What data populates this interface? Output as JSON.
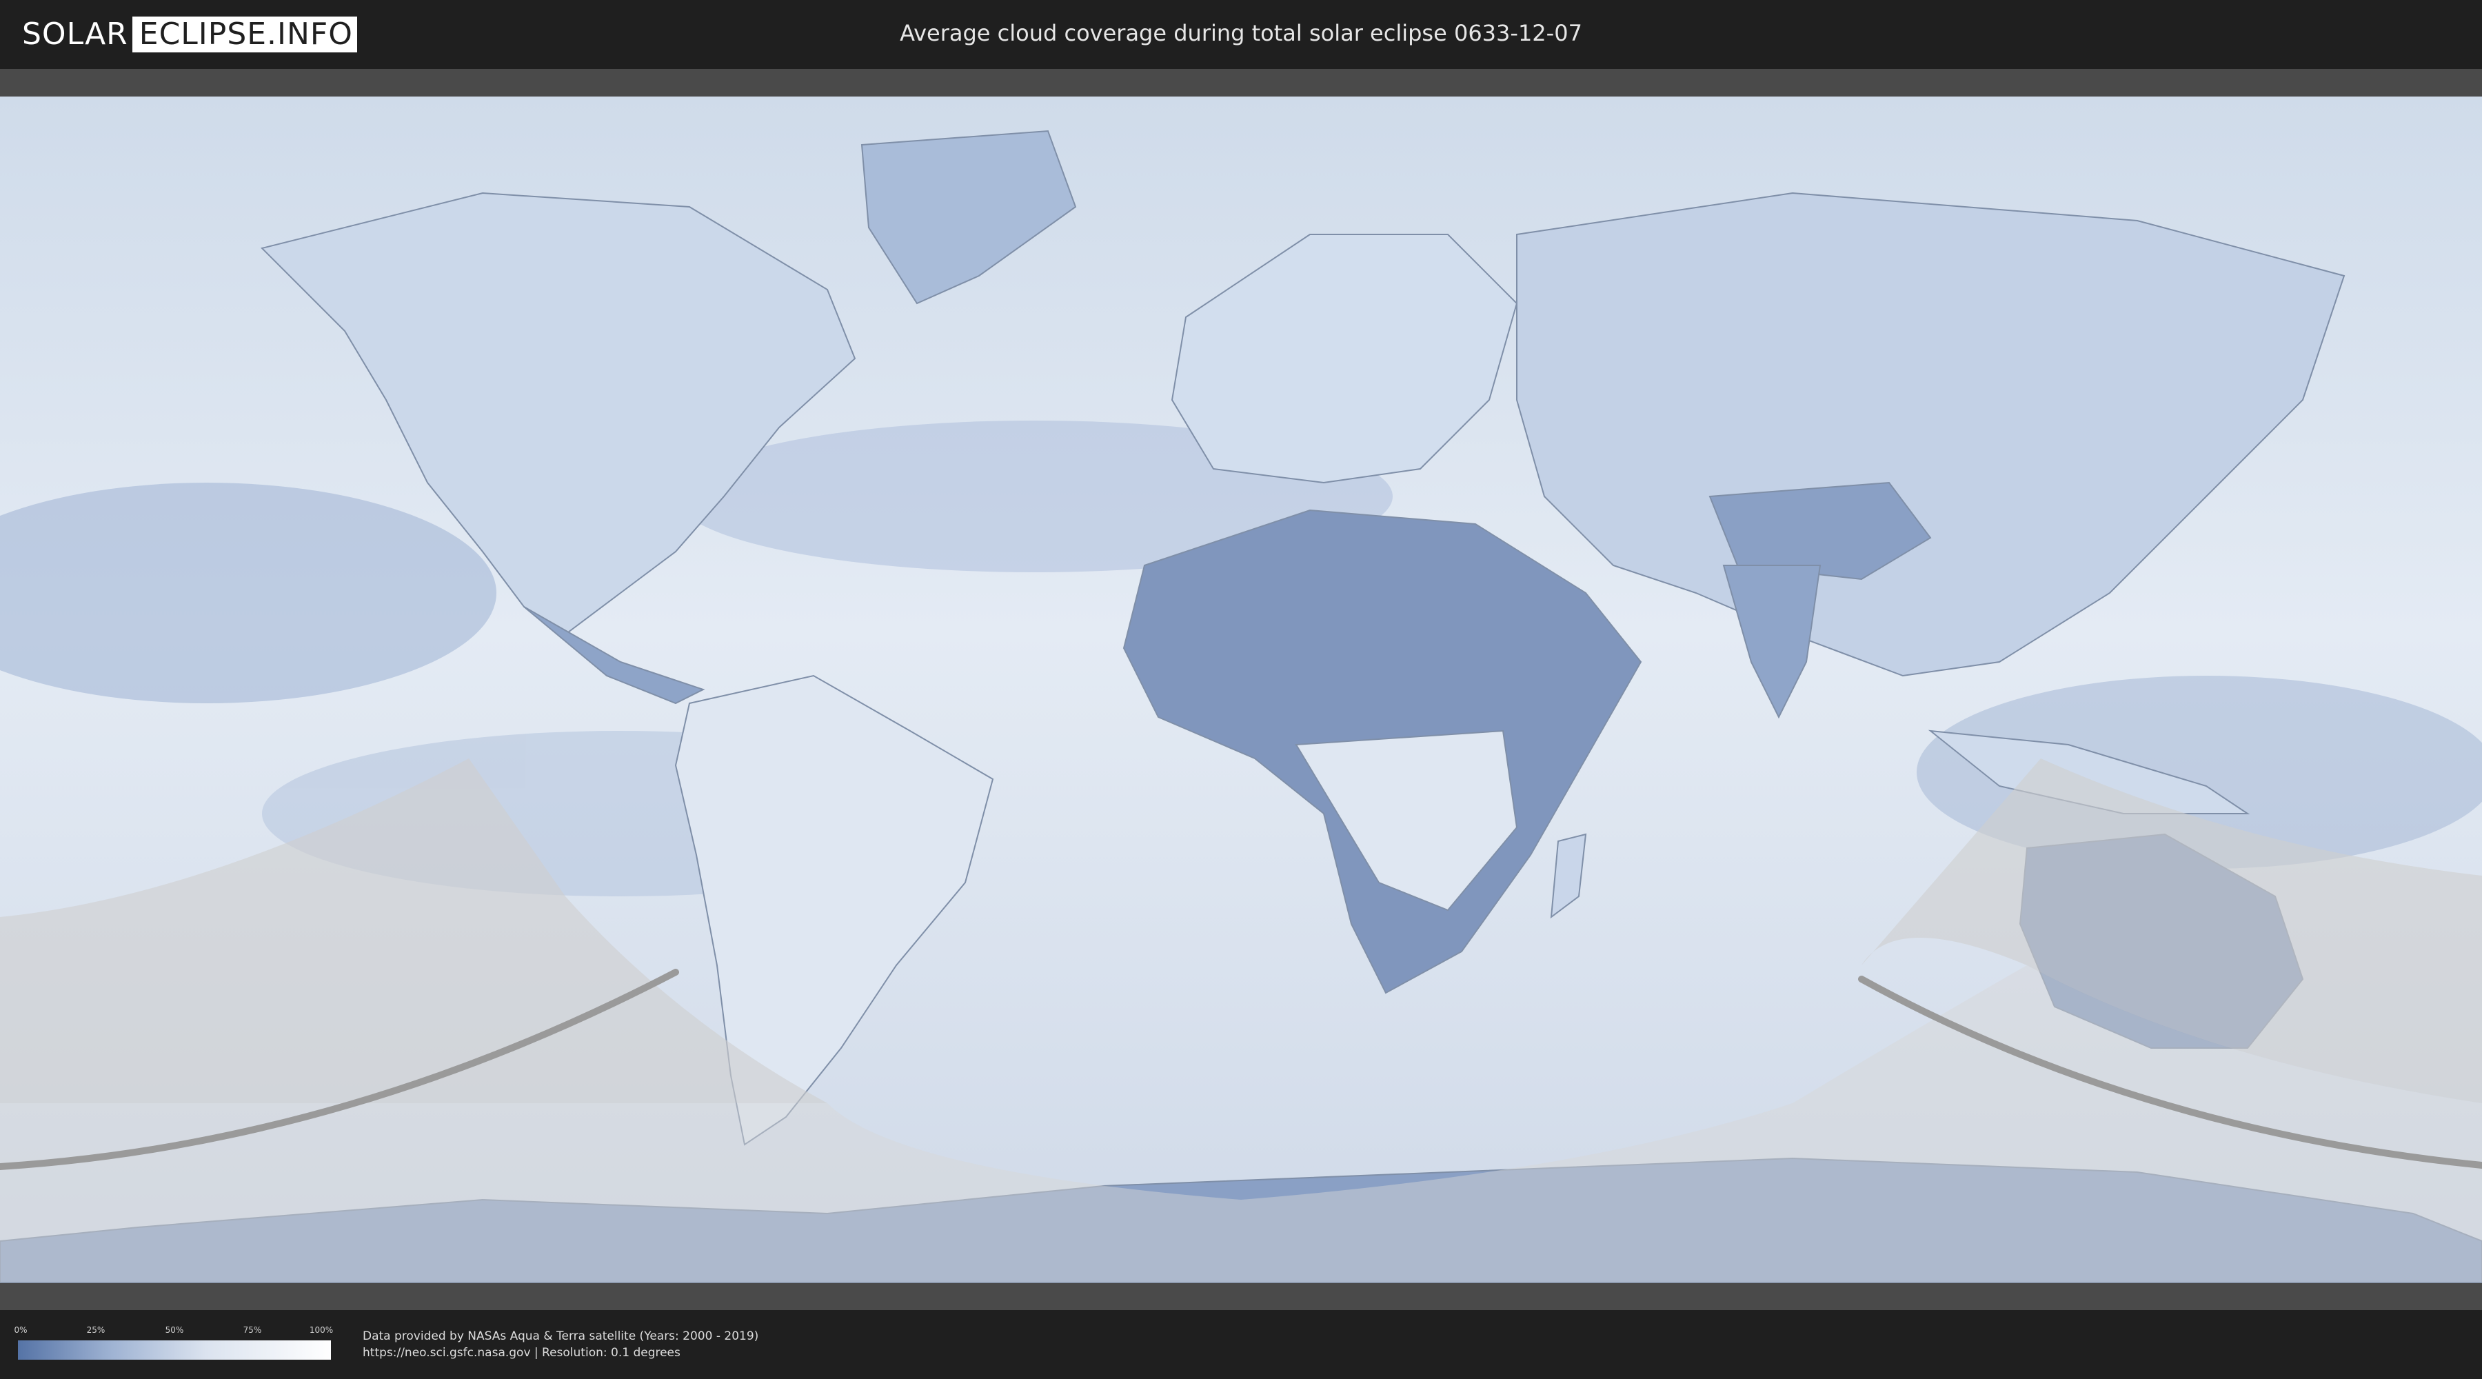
{
  "header": {
    "logo_part1": "SOLAR",
    "logo_part2": "ECLIPSE.INFO",
    "title": "Average cloud coverage during total solar eclipse 0633-12-07"
  },
  "legend": {
    "ticks": [
      "0%",
      "25%",
      "50%",
      "75%",
      "100%"
    ],
    "colors": {
      "low": "#5573a6",
      "mid": "#dbe3ef",
      "high": "#ffffff"
    }
  },
  "footer": {
    "credit_line1": "Data provided by NASAs Aqua & Terra satellite (Years: 2000 - 2019)",
    "credit_line2": "https://neo.sci.gsfc.nasa.gov | Resolution: 0.1 degrees"
  },
  "map": {
    "projection": "equirectangular",
    "layer": "average cloud coverage",
    "colors": {
      "ocean_cloud": "#dbe5f1",
      "clear_sky": "#7c95bf",
      "night_overlay": "#c8c8c8",
      "eclipse_track": "#9a9a9a"
    }
  }
}
